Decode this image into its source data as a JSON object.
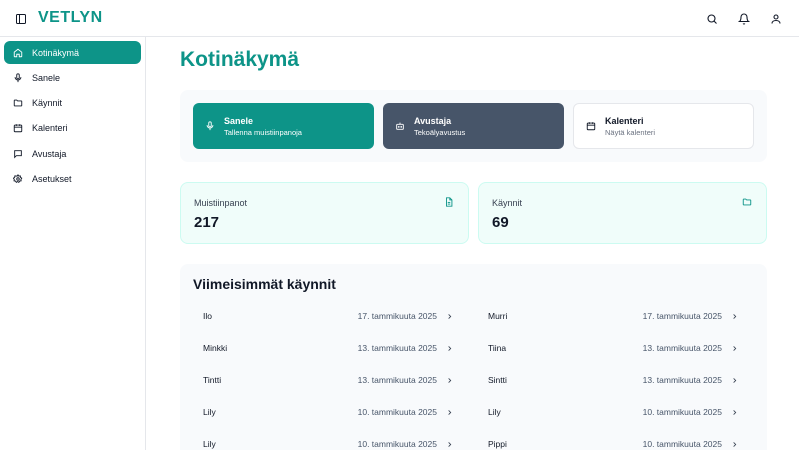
{
  "header": {
    "brand": "VETLYN",
    "icons": [
      "sidebar-toggle-icon",
      "search-icon",
      "bell-icon",
      "user-icon"
    ]
  },
  "sidebar": {
    "items": [
      {
        "label": "Kotinäkymä",
        "icon": "home-icon",
        "active": true
      },
      {
        "label": "Sanele",
        "icon": "microphone-icon",
        "active": false
      },
      {
        "label": "Käynnit",
        "icon": "folder-icon",
        "active": false
      },
      {
        "label": "Kalenteri",
        "icon": "calendar-icon",
        "active": false
      },
      {
        "label": "Avustaja",
        "icon": "message-icon",
        "active": false
      },
      {
        "label": "Asetukset",
        "icon": "settings-icon",
        "active": false
      }
    ]
  },
  "main": {
    "title": "Kotinäkymä",
    "quick_actions": [
      {
        "title": "Sanele",
        "subtitle": "Tallenna muistiinpanoja",
        "icon": "microphone-icon"
      },
      {
        "title": "Avustaja",
        "subtitle": "Tekoälyavustus",
        "icon": "bot-icon"
      },
      {
        "title": "Kalenteri",
        "subtitle": "Näytä kalenteri",
        "icon": "calendar-icon"
      }
    ],
    "stats": [
      {
        "label": "Muistiinpanot",
        "value": "217",
        "icon": "file-icon"
      },
      {
        "label": "Käynnit",
        "value": "69",
        "icon": "folder-icon"
      }
    ],
    "recent": {
      "heading": "Viimeisimmät käynnit",
      "left": [
        {
          "name": "Ilo",
          "date": "17. tammikuuta 2025"
        },
        {
          "name": "Minkki",
          "date": "13. tammikuuta 2025"
        },
        {
          "name": "Tintti",
          "date": "13. tammikuuta 2025"
        },
        {
          "name": "Lily",
          "date": "10. tammikuuta 2025"
        },
        {
          "name": "Lily",
          "date": "10. tammikuuta 2025"
        }
      ],
      "right": [
        {
          "name": "Murri",
          "date": "17. tammikuuta 2025"
        },
        {
          "name": "Tiina",
          "date": "13. tammikuuta 2025"
        },
        {
          "name": "Sintti",
          "date": "13. tammikuuta 2025"
        },
        {
          "name": "Lily",
          "date": "10. tammikuuta 2025"
        },
        {
          "name": "Pippi",
          "date": "10. tammikuuta 2025"
        }
      ]
    }
  },
  "colors": {
    "accent": "#0d9488",
    "slate": "#475569"
  }
}
